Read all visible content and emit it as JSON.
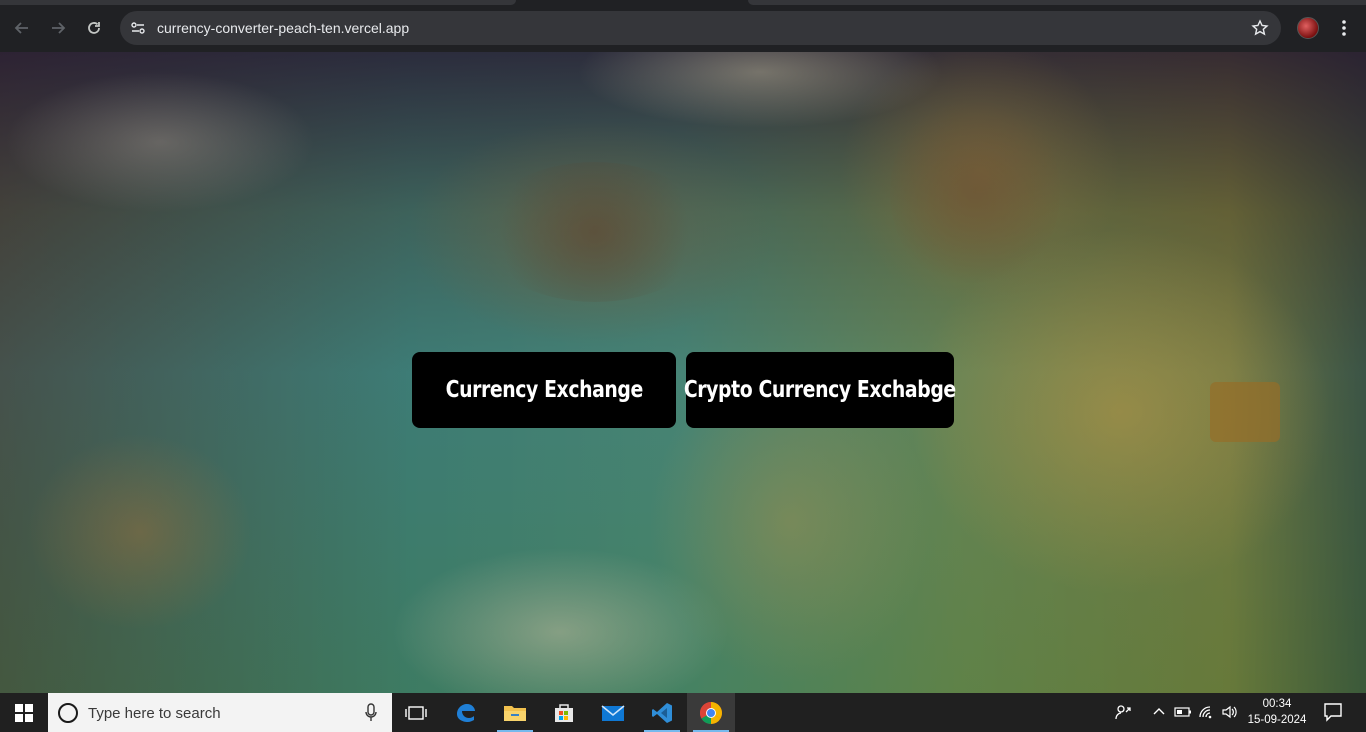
{
  "browser": {
    "url": "currency-converter-peach-ten.vercel.app",
    "icons": [
      "back-icon",
      "forward-icon",
      "reload-icon",
      "site-info-icon",
      "bookmark-star-icon",
      "profile-avatar",
      "more-menu-icon"
    ]
  },
  "page": {
    "buttons": [
      {
        "label": "Currency Exchange"
      },
      {
        "label": "Crypto Currency Exchabge"
      }
    ]
  },
  "taskbar": {
    "search_placeholder": "Type here to search",
    "apps": [
      "task-view-icon",
      "edge-icon",
      "file-explorer-icon",
      "microsoft-store-icon",
      "mail-icon",
      "vscode-icon",
      "chrome-icon"
    ],
    "time": "00:34",
    "date": "15-09-2024"
  }
}
